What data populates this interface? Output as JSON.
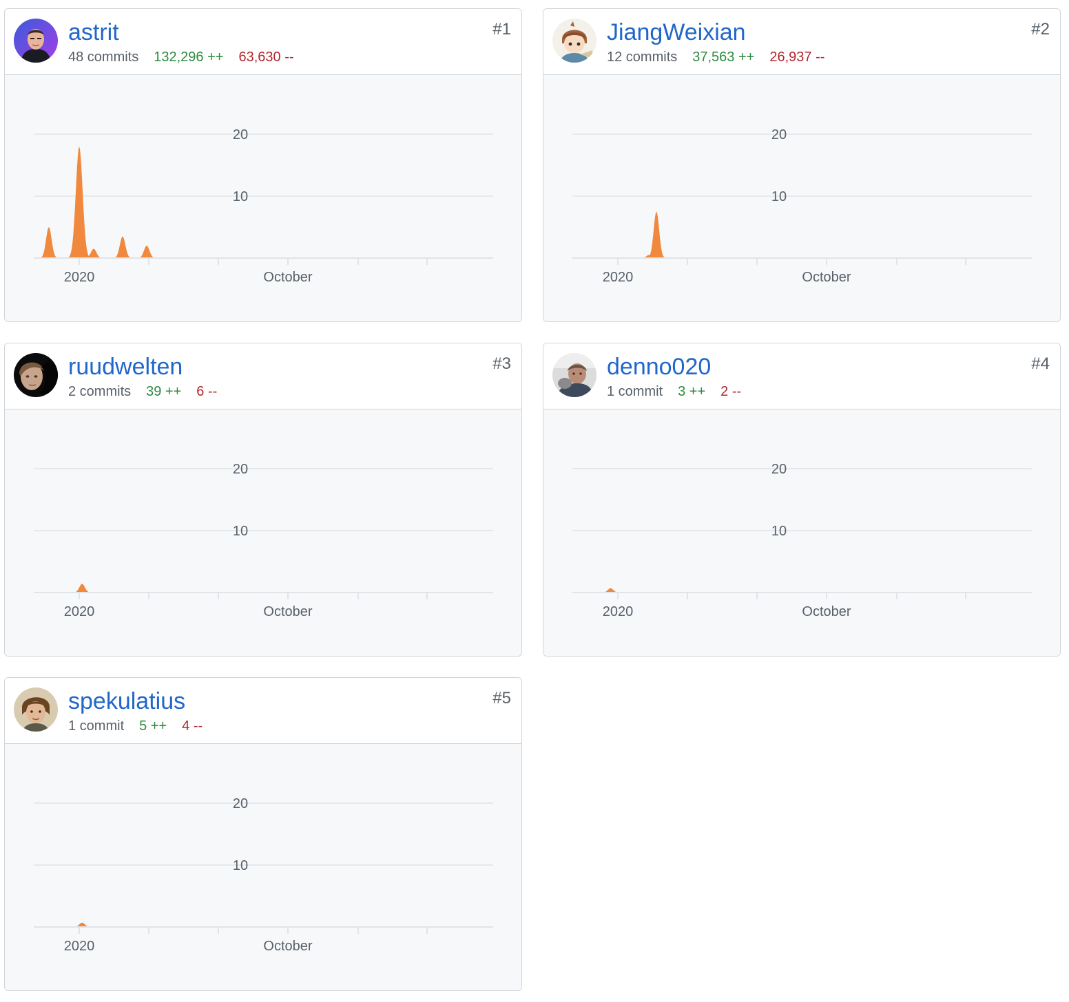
{
  "contributors": [
    {
      "rank": "#1",
      "username": "astrit",
      "commits": "48 commits",
      "additions": "132,296 ++",
      "deletions": "63,630 --",
      "avatar": "avatar-astrit",
      "chart_data": {
        "type": "area",
        "title": "",
        "xlabel": "",
        "ylabel": "",
        "ylim": [
          0,
          25
        ],
        "y_ticks": [
          "10",
          "20"
        ],
        "x_tick_labels": [
          "2020",
          "October"
        ],
        "series": [
          {
            "values": [
              {
                "week": -6.3,
                "commits": 5
              },
              {
                "week": 0,
                "commits": 18
              },
              {
                "week": 3,
                "commits": 1.5
              },
              {
                "week": 9,
                "commits": 3.5
              },
              {
                "week": 14,
                "commits": 2
              }
            ]
          }
        ]
      }
    },
    {
      "rank": "#2",
      "username": "JiangWeixian",
      "commits": "12 commits",
      "additions": "37,563 ++",
      "deletions": "26,937 --",
      "avatar": "avatar-jiangweixian",
      "chart_data": {
        "type": "area",
        "title": "",
        "xlabel": "",
        "ylabel": "",
        "ylim": [
          0,
          25
        ],
        "y_ticks": [
          "10",
          "20"
        ],
        "x_tick_labels": [
          "2020",
          "October"
        ],
        "series": [
          {
            "values": [
              {
                "week": 6.5,
                "commits": 0.5
              },
              {
                "week": 8,
                "commits": 7.5
              }
            ]
          }
        ]
      }
    },
    {
      "rank": "#3",
      "username": "ruudwelten",
      "commits": "2 commits",
      "additions": "39 ++",
      "deletions": "6 --",
      "avatar": "avatar-ruudwelten",
      "chart_data": {
        "type": "area",
        "title": "",
        "xlabel": "",
        "ylabel": "",
        "ylim": [
          0,
          25
        ],
        "y_ticks": [
          "10",
          "20"
        ],
        "x_tick_labels": [
          "2020",
          "October"
        ],
        "series": [
          {
            "values": [
              {
                "week": 0.6,
                "commits": 1.4
              }
            ]
          }
        ]
      }
    },
    {
      "rank": "#4",
      "username": "denno020",
      "commits": "1 commit",
      "additions": "3 ++",
      "deletions": "2 --",
      "avatar": "avatar-denno020",
      "chart_data": {
        "type": "area",
        "title": "",
        "xlabel": "",
        "ylabel": "",
        "ylim": [
          0,
          25
        ],
        "y_ticks": [
          "10",
          "20"
        ],
        "x_tick_labels": [
          "2020",
          "October"
        ],
        "series": [
          {
            "values": [
              {
                "week": -1.5,
                "commits": 0.7
              }
            ]
          }
        ]
      }
    },
    {
      "rank": "#5",
      "username": "spekulatius",
      "commits": "1 commit",
      "additions": "5 ++",
      "deletions": "4 --",
      "avatar": "avatar-spekulatius",
      "chart_data": {
        "type": "area",
        "title": "",
        "xlabel": "",
        "ylabel": "",
        "ylim": [
          0,
          25
        ],
        "y_ticks": [
          "10",
          "20"
        ],
        "x_tick_labels": [
          "2020",
          "October"
        ],
        "series": [
          {
            "values": [
              {
                "week": 0.6,
                "commits": 0.7
              }
            ]
          }
        ]
      }
    }
  ],
  "colors": {
    "area": "#f0883e",
    "username": "#2167c9",
    "additions": "#2c8a3e",
    "deletions": "#b3262d",
    "grid": "#e1e4e8",
    "axis_text": "#586069",
    "chart_bg": "#f6f8fa"
  }
}
